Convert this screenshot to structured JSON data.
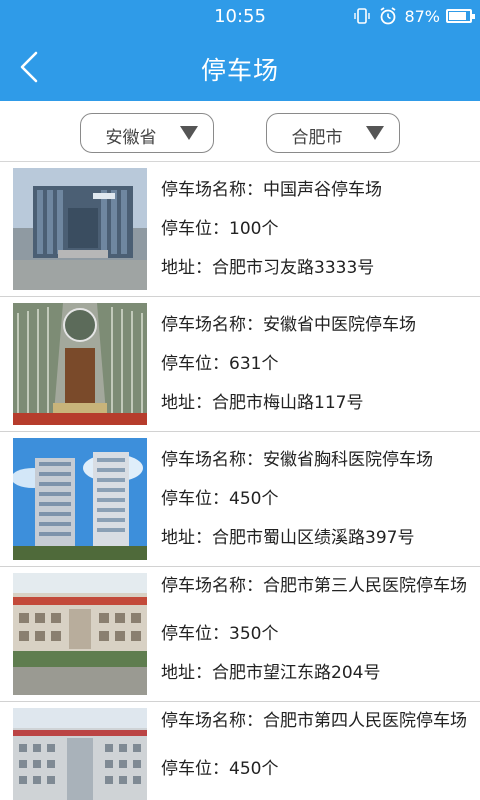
{
  "status": {
    "time": "10:55",
    "battery_percent": "87%",
    "battery_level": 0.87
  },
  "nav": {
    "title": "停车场",
    "back_icon": "chevron-left-icon"
  },
  "filters": {
    "province": {
      "label": "安徽省",
      "icon": "triangle-down-icon"
    },
    "city": {
      "label": "合肥市",
      "icon": "triangle-down-icon"
    }
  },
  "labels": {
    "name": "停车场名称：",
    "spaces": "停车位：",
    "address": "地址："
  },
  "colors": {
    "accent": "#2f9be8",
    "divider": "#d2d2d2"
  },
  "lots": [
    {
      "name": "中国声谷停车场",
      "spaces": "100个",
      "address": "合肥市习友路3333号"
    },
    {
      "name": "安徽省中医院停车场",
      "spaces": "631个",
      "address": "合肥市梅山路117号"
    },
    {
      "name": "安徽省胸科医院停车场",
      "spaces": "450个",
      "address": "合肥市蜀山区绩溪路397号"
    },
    {
      "name": "合肥市第三人民医院停车场",
      "spaces": "350个",
      "address": "合肥市望江东路204号"
    },
    {
      "name": "合肥市第四人民医院停车场",
      "spaces": "450个",
      "address": ""
    }
  ]
}
